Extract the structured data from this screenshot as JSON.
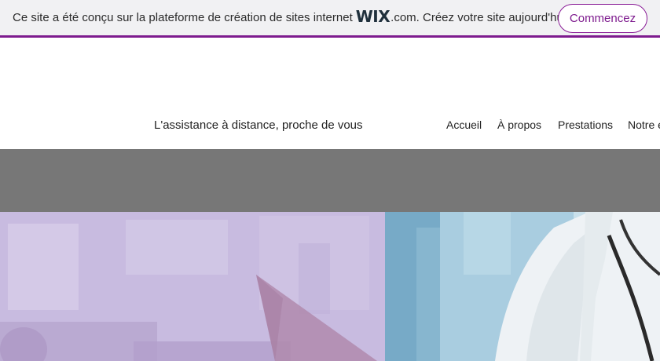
{
  "banner": {
    "text_before_logo": "Ce site a été conçu sur la plateforme de création de sites internet ",
    "logo": "WIX",
    "text_after_logo": ".com. Créez votre site aujourd'hui.",
    "cta_label": "Commencez"
  },
  "header": {
    "tagline": "L'assistance à distance, proche de vous",
    "nav": [
      "Accueil",
      "À propos",
      "Prestations",
      "Notre équipe"
    ]
  },
  "colors": {
    "brand_purple": "#7e1b8e",
    "grey_band": "#777777"
  }
}
